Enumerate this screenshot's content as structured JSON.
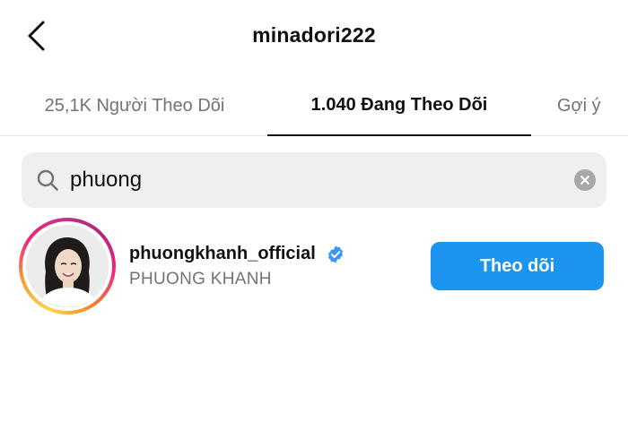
{
  "header": {
    "title": "minadori222",
    "back_icon": "chevron-left-icon"
  },
  "tabs": [
    {
      "label": "25,1K Người Theo Dõi",
      "active": false
    },
    {
      "label": "1.040 Đang Theo Dõi",
      "active": true
    },
    {
      "label": "Gợi ý",
      "active": false
    }
  ],
  "search": {
    "value": "phuong",
    "icon": "search-icon",
    "clear_icon": "clear-icon"
  },
  "results": [
    {
      "username": "phuongkhanh_official",
      "verified": true,
      "full_name": "PHUONG KHANH",
      "follow_label": "Theo dõi"
    }
  ],
  "colors": {
    "accent": "#1b95f0",
    "verified_badge": "#3897f0",
    "muted_text": "#737373",
    "search_bg": "#efefef"
  }
}
